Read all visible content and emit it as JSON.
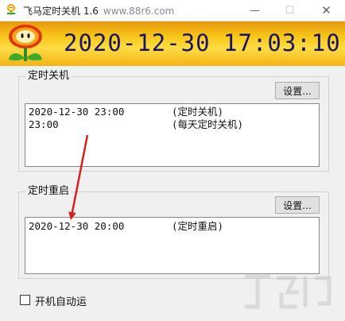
{
  "window": {
    "title": "飞马定时关机 1.6",
    "watermark": "www.88r6.com",
    "minimize_symbol": "—",
    "maximize_symbol": "☐",
    "close_symbol": "✕"
  },
  "banner": {
    "date": "2020-12-30",
    "time": "17:03:10",
    "time_color": "#1a1464"
  },
  "shutdown_group": {
    "legend": "定时关机",
    "settings_button": "设置...",
    "items": [
      {
        "when": "2020-12-30 23:00",
        "what": "(定时关机)"
      },
      {
        "when": "23:00",
        "what": "(每天定时关机)"
      }
    ]
  },
  "restart_group": {
    "legend": "定时重启",
    "settings_button": "设置...",
    "items": [
      {
        "when": "2020-12-30 20:00",
        "what": "(定时重启)"
      }
    ]
  },
  "autostart": {
    "label": "开机自动运",
    "checked": false
  },
  "annotation": {
    "arrow_color": "#d42020"
  }
}
